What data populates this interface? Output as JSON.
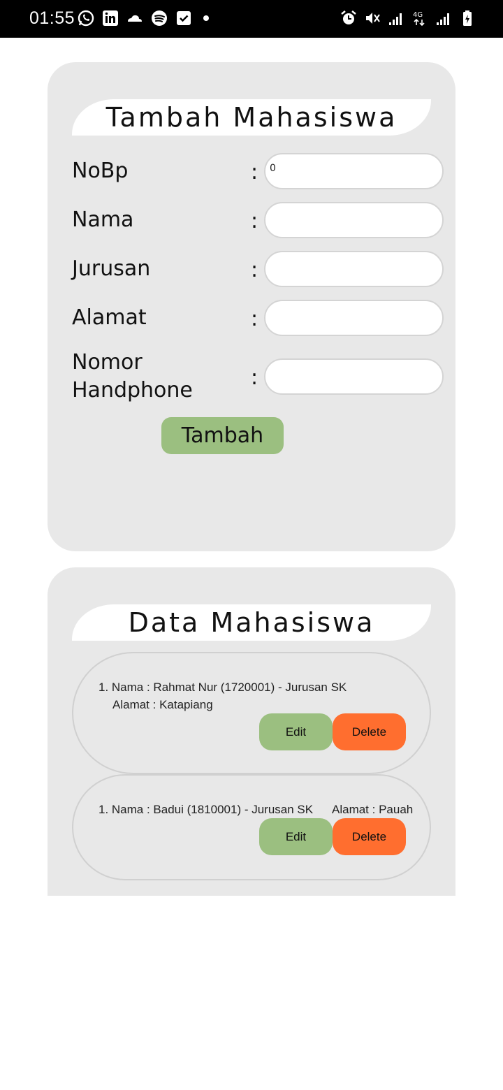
{
  "status_bar": {
    "time": "01:55",
    "left_icons": [
      "whatsapp-icon",
      "linkedin-icon",
      "cloud-app-icon",
      "spotify-icon",
      "checkbox-app-icon"
    ],
    "right_icons": [
      "alarm-icon",
      "mute-icon",
      "signal-icon",
      "4g-icon",
      "signal-icon",
      "battery-icon"
    ],
    "network_label": "4G"
  },
  "form": {
    "title": "Tambah Mahasiswa",
    "fields": [
      {
        "label": "NoBp",
        "value": "0"
      },
      {
        "label": "Nama",
        "value": ""
      },
      {
        "label": "Jurusan",
        "value": ""
      },
      {
        "label": "Alamat",
        "value": ""
      },
      {
        "label_line1": "Nomor",
        "label_line2": "Handphone",
        "value": ""
      }
    ],
    "colon": ":",
    "submit_label": "Tambah"
  },
  "data": {
    "title": "Data Mahasiswa",
    "items": [
      {
        "line1": "1. Nama : Rahmat Nur (1720001) - Jurusan SK",
        "line2": "Alamat : Katapiang",
        "edit_label": "Edit",
        "delete_label": "Delete"
      },
      {
        "line1": "1. Nama : Badui (1810001) - Jurusan SK",
        "line2": "Alamat : Pauah",
        "edit_label": "Edit",
        "delete_label": "Delete"
      }
    ]
  },
  "colors": {
    "card_bg": "#e8e8e8",
    "edit_green": "#9bbf80",
    "delete_orange": "#ff6e2f",
    "status_bar": "#000000"
  }
}
